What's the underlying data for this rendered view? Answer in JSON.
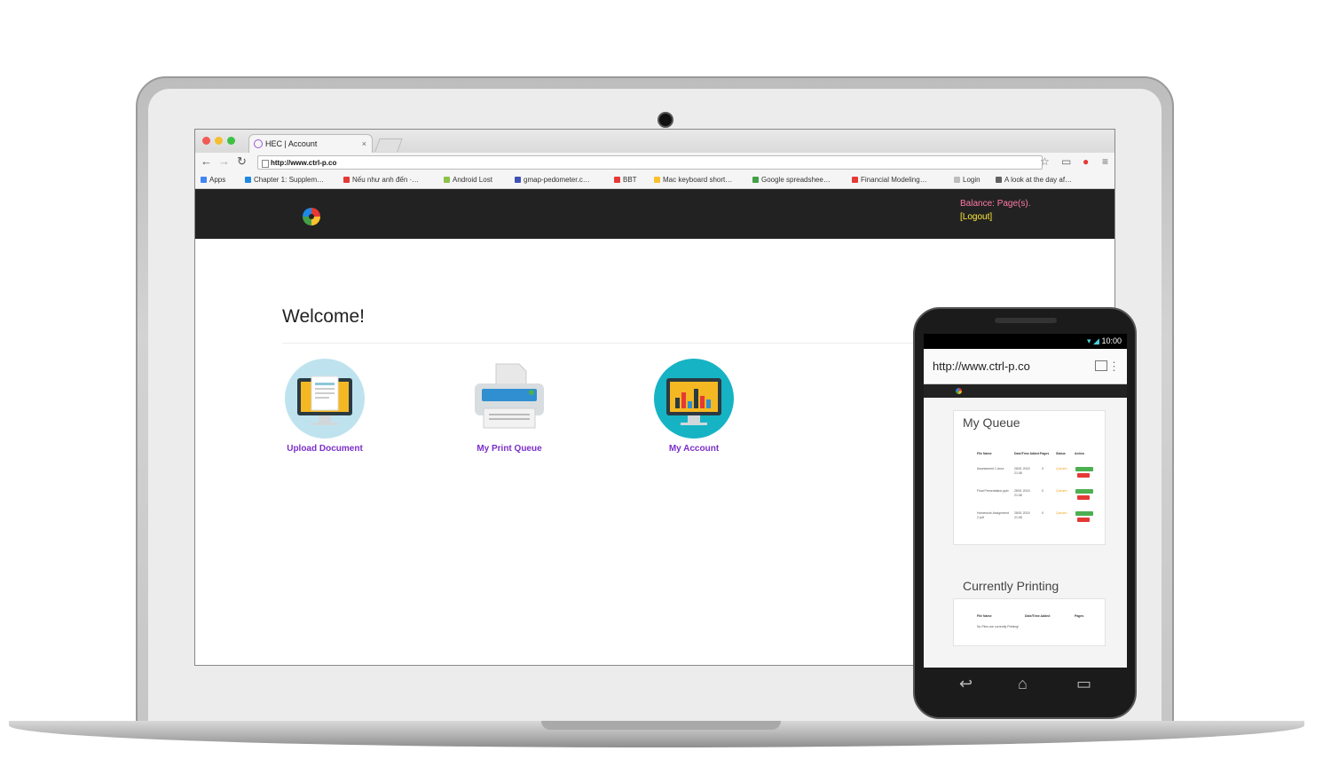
{
  "browser": {
    "tab_title": "HEC | Account",
    "tab_close": "×",
    "url": "http://www.ctrl-p.co",
    "bookmarks": [
      {
        "label": "Apps",
        "color": "#4285f4"
      },
      {
        "label": "Chapter 1: Supplem…",
        "color": "#1e88e5"
      },
      {
        "label": "Nếu như anh đến ·…",
        "color": "#e53935"
      },
      {
        "label": "Android Lost",
        "color": "#8bc34a"
      },
      {
        "label": "gmap-pedometer.c…",
        "color": "#3f51b5"
      },
      {
        "label": "BBT",
        "color": "#e53935"
      },
      {
        "label": "Mac keyboard short…",
        "color": "#fbc02d"
      },
      {
        "label": "Google spreadshee…",
        "color": "#43a047"
      },
      {
        "label": "Financial Modeling…",
        "color": "#e53935"
      },
      {
        "label": "Login",
        "color": "#bdbdbd"
      },
      {
        "label": "A look at the day af…",
        "color": "#616161"
      }
    ]
  },
  "site_header": {
    "balance": "Balance: Page(s).",
    "logout": "[Logout]"
  },
  "main": {
    "welcome": "Welcome!",
    "tiles": [
      {
        "label": "Upload Document",
        "icon": "monitor-document-icon"
      },
      {
        "label": "My Print Queue",
        "icon": "printer-icon"
      },
      {
        "label": "My Account",
        "icon": "monitor-chart-icon"
      }
    ]
  },
  "phone": {
    "time": "10:00",
    "url": "http://www.ctrl-p.co",
    "queue_title": "My Queue",
    "queue_headers": [
      "File Name",
      "Date/Time Added",
      "Pages",
      "Status",
      "Action"
    ],
    "queue_rows": [
      {
        "file": "Assessment 1.docx",
        "date": "28/01 2015 21:08",
        "pages": "0",
        "status": "Queued"
      },
      {
        "file": "Final Presentation.pptx",
        "date": "28/01 2015 21:08",
        "pages": "0",
        "status": "Queued"
      },
      {
        "file": "Homework Assignment 2.pdf",
        "date": "28/01 2015 21:08",
        "pages": "0",
        "status": "Queued"
      }
    ],
    "printing_title": "Currently Printing",
    "printing_headers": [
      "File Name",
      "Date/Time Added",
      "Pages"
    ],
    "printing_empty": "No Files are currently Printing!"
  },
  "colors": {
    "header_bg": "#222222",
    "link_purple": "#7b2fc9",
    "balance_pink": "#ff7aa8",
    "logout_yellow": "#ffeb3b",
    "btn_green": "#4caf50",
    "btn_red": "#e53935"
  }
}
